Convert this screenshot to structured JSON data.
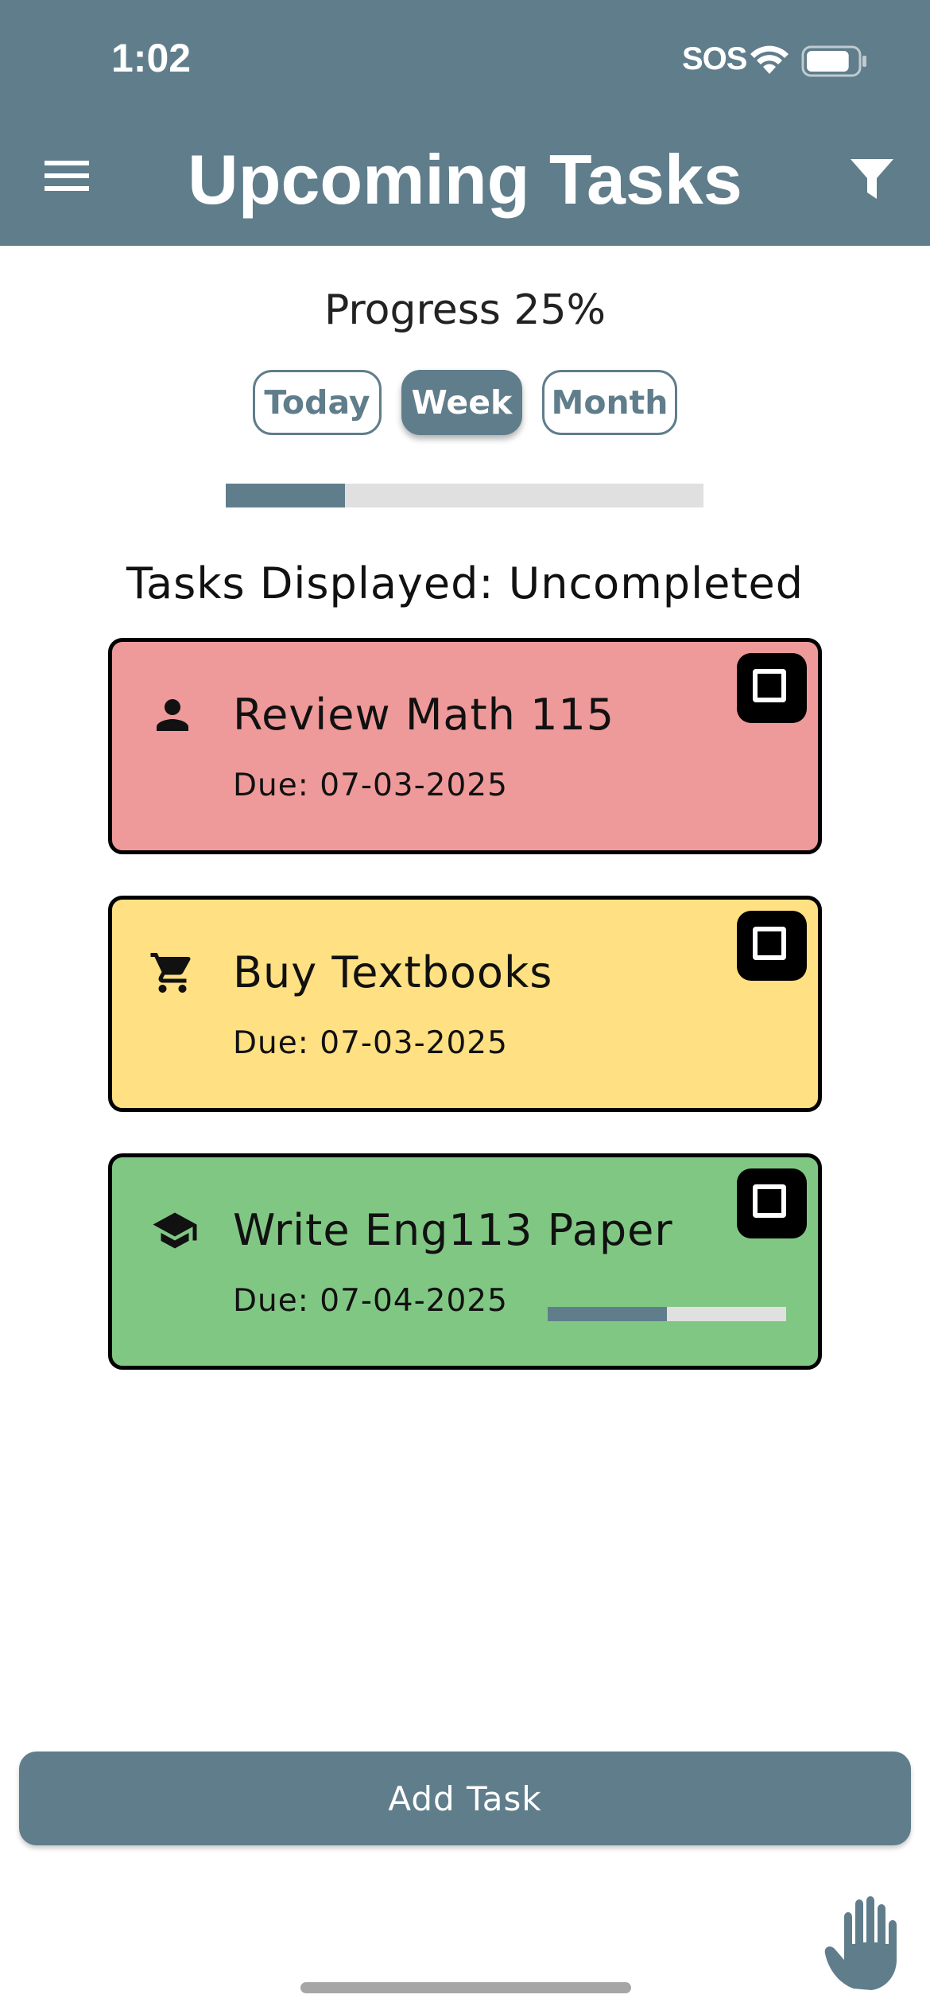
{
  "status_bar": {
    "time": "1:02",
    "carrier": "SOS",
    "wifi_icon": "wifi-icon",
    "battery_icon": "battery-icon",
    "battery_level": 0.85
  },
  "header": {
    "title": "Upcoming Tasks",
    "menu_icon": "hamburger-menu-icon",
    "filter_icon": "filter-icon",
    "color": "#607d8b"
  },
  "progress": {
    "label": "Progress 25%",
    "value": 0.25
  },
  "range_tabs": [
    {
      "label": "Today",
      "selected": false
    },
    {
      "label": "Week",
      "selected": true
    },
    {
      "label": "Month",
      "selected": false
    }
  ],
  "tasks_label": "Tasks Displayed: Uncompleted",
  "tasks": [
    {
      "title": "Review Math 115",
      "due": "Due: 07-03-2025",
      "icon": "person-icon",
      "color": "#ef9a9a",
      "checked": false,
      "progress": null
    },
    {
      "title": "Buy Textbooks",
      "due": "Due: 07-03-2025",
      "icon": "shopping-cart-icon",
      "color": "#ffe082",
      "checked": false,
      "progress": null
    },
    {
      "title": "Write Eng113 Paper",
      "due": "Due: 07-04-2025",
      "icon": "graduation-cap-icon",
      "color": "#81c784",
      "checked": false,
      "progress": 0.5
    }
  ],
  "add_task_label": "Add Task",
  "accessibility_icon": "hand-icon"
}
